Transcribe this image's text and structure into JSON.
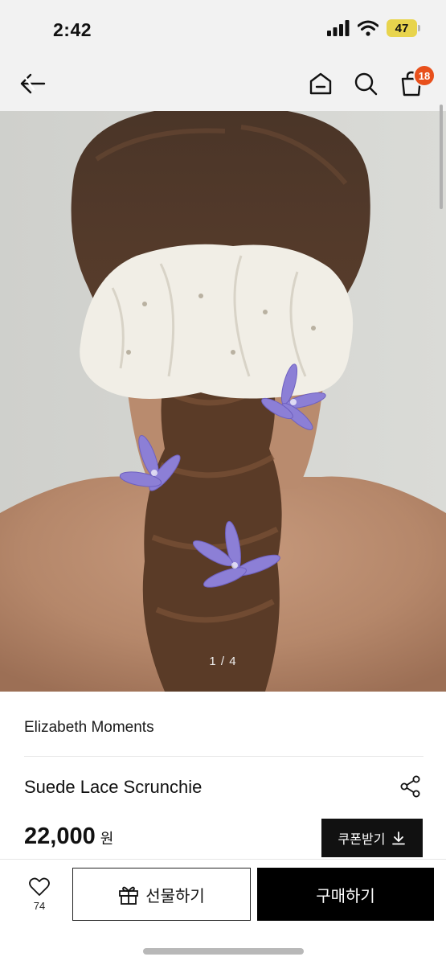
{
  "status_bar": {
    "time": "2:42",
    "battery": "47"
  },
  "header": {
    "cart_count": "18"
  },
  "product": {
    "image_counter": "1 / 4",
    "brand": "Elizabeth Moments",
    "name": "Suede Lace Scrunchie",
    "price": "22,000",
    "currency": "원",
    "coupon_label": "쿠폰받기"
  },
  "actions": {
    "like_count": "74",
    "gift_label": "선물하기",
    "buy_label": "구매하기"
  }
}
